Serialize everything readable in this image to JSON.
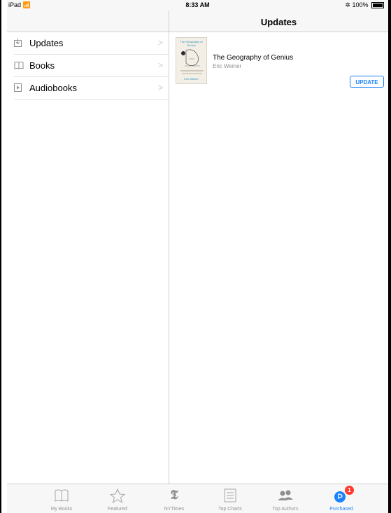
{
  "status": {
    "device": "iPad",
    "time": "8:33 AM",
    "battery": "100%"
  },
  "left_menu": {
    "items": [
      {
        "label": "Updates",
        "icon": "download-box-icon"
      },
      {
        "label": "Books",
        "icon": "book-icon"
      },
      {
        "label": "Audiobooks",
        "icon": "audiobook-icon"
      }
    ]
  },
  "right": {
    "title": "Updates",
    "update_row": {
      "book_title": "The Geography of Genius",
      "author": "Eric Weiner",
      "cover_title": "The Geography of Genius",
      "cover_author": "Eric Weiner",
      "button_label": "UPDATE"
    }
  },
  "tabbar": {
    "tabs": [
      {
        "label": "My Books",
        "icon": "open-book-icon"
      },
      {
        "label": "Featured",
        "icon": "star-icon"
      },
      {
        "label": "NYTimes",
        "icon": "nytimes-logo-icon"
      },
      {
        "label": "Top Charts",
        "icon": "list-icon"
      },
      {
        "label": "Top Authors",
        "icon": "people-icon"
      },
      {
        "label": "Purchased",
        "icon": "purchased-icon",
        "badge": "1"
      }
    ]
  },
  "colors": {
    "accent": "#1a82fb",
    "badge": "#ff3b30"
  }
}
